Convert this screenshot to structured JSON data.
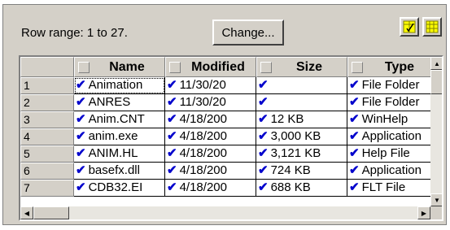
{
  "toolbar": {
    "row_range_label": "Row range: 1 to 27.",
    "change_label": "Change...",
    "icon_buttons": [
      "select-columns-icon",
      "grid-icon"
    ]
  },
  "grid": {
    "columns": [
      {
        "label": "Name"
      },
      {
        "label": "Modified"
      },
      {
        "label": "Size"
      },
      {
        "label": "Type"
      }
    ],
    "rows": [
      {
        "num": "1",
        "name": "Animation",
        "modified": "11/30/20",
        "size": "",
        "type": "File Folder"
      },
      {
        "num": "2",
        "name": "ANRES",
        "modified": "11/30/20",
        "size": "",
        "type": "File Folder"
      },
      {
        "num": "3",
        "name": "Anim.CNT",
        "modified": "4/18/200",
        "size": "12 KB",
        "type": "WinHelp"
      },
      {
        "num": "4",
        "name": "anim.exe",
        "modified": "4/18/200",
        "size": "3,000 KB",
        "type": "Application"
      },
      {
        "num": "5",
        "name": "ANIM.HL",
        "modified": "4/18/200",
        "size": "3,121 KB",
        "type": "Help File"
      },
      {
        "num": "6",
        "name": "basefx.dll",
        "modified": "4/18/200",
        "size": "724 KB",
        "type": "Application"
      },
      {
        "num": "7",
        "name": "CDB32.EI",
        "modified": "4/18/200",
        "size": "688 KB",
        "type": "FLT File"
      }
    ],
    "check_glyph": "✔"
  },
  "colors": {
    "face": "#d4d0c8",
    "check": "#0000cc"
  }
}
